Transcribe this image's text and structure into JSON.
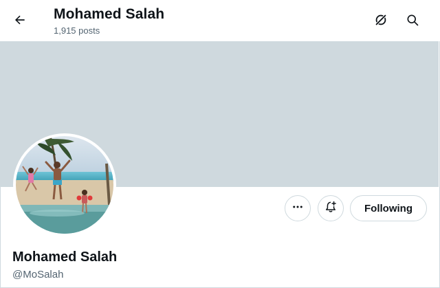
{
  "header": {
    "title": "Mohamed Salah",
    "post_count": "1,915 posts",
    "back_icon": "arrow-left-icon",
    "grok_icon": "grok-icon",
    "search_icon": "search-icon"
  },
  "banner": {
    "color": "#cfd9de"
  },
  "profile": {
    "display_name": "Mohamed Salah",
    "handle": "@MoSalah",
    "avatar_alt": "beach-family-photo"
  },
  "actions": {
    "more_icon": "more-horizontal-icon",
    "notify_icon": "bell-plus-icon",
    "follow_label": "Following"
  },
  "colors": {
    "text_primary": "#0f1419",
    "text_secondary": "#536471",
    "border": "#cfd9de"
  }
}
